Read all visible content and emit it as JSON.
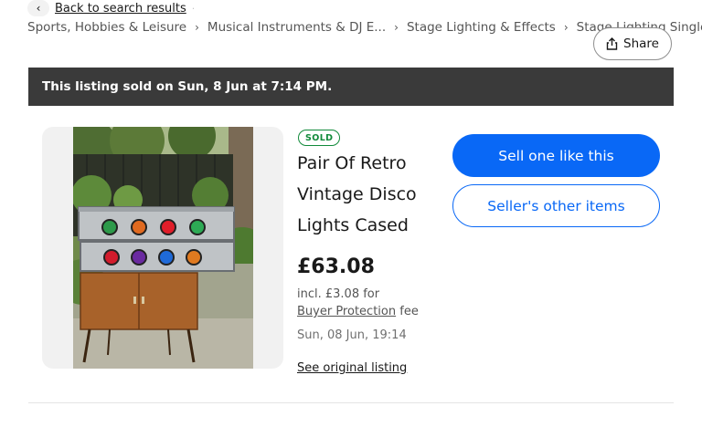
{
  "nav": {
    "back_label": "Back to search results",
    "back_icon": "chevron-left-icon",
    "breadcrumbs": [
      "Sports, Hobbies & Leisure",
      "Musical Instruments & DJ E...",
      "Stage Lighting & Effects",
      "Stage Lighting Single Un"
    ]
  },
  "share": {
    "label": "Share",
    "icon": "share-icon"
  },
  "banner": {
    "text": "This listing sold on Sun, 8 Jun at 7:14 PM."
  },
  "listing": {
    "badge": "SOLD",
    "title": "Pair Of Retro Vintage Disco Lights Cased",
    "price": "£63.08",
    "fee_line1": "incl. £3.08 for",
    "fee_link": "Buyer Protection",
    "fee_suffix": " fee",
    "date": "Sun, 08 Jun, 19:14",
    "original_link": "See original listing"
  },
  "actions": {
    "sell_label": "Sell one like this",
    "seller_items_label": "Seller's other items"
  },
  "colors": {
    "primary": "#0968f6",
    "banner_bg": "#3a3a3a",
    "sold_green": "#118a3a"
  }
}
